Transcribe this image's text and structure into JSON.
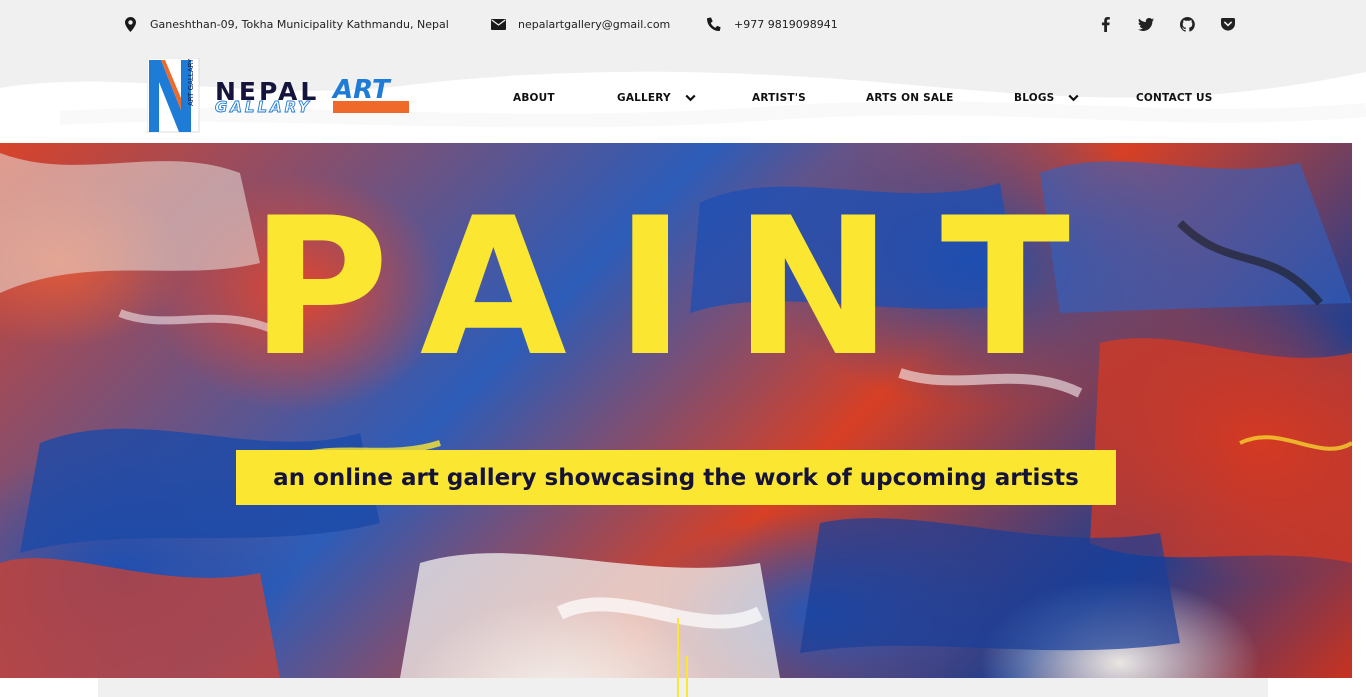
{
  "topbar": {
    "address": "Ganeshthan-09, Tokha Municipality Kathmandu, Nepal",
    "address_icon": "map-marker-icon",
    "email": "nepalartgallery@gmail.com",
    "email_icon": "envelope-icon",
    "phone": "+977 9819098941",
    "phone_icon": "phone-icon",
    "social": [
      {
        "name": "facebook-icon"
      },
      {
        "name": "twitter-icon"
      },
      {
        "name": "github-icon"
      },
      {
        "name": "pocket-icon"
      }
    ]
  },
  "logo": {
    "line1_a": "NEPAL",
    "line1_b": "ART",
    "line2": "GALLARY",
    "vertical": "ART GALLARY",
    "colors": {
      "blue": "#1e7bd6",
      "orange": "#ef6a2a",
      "navy": "#14143c"
    }
  },
  "nav": {
    "items": [
      {
        "label": "ABOUT",
        "dropdown": false
      },
      {
        "label": "GALLERY",
        "dropdown": true
      },
      {
        "label": "ARTIST'S",
        "dropdown": false
      },
      {
        "label": "ARTS ON SALE",
        "dropdown": false
      },
      {
        "label": "BLOGS",
        "dropdown": true
      },
      {
        "label": "CONTACT US",
        "dropdown": false
      }
    ]
  },
  "hero": {
    "title": "PAINT",
    "tagline": "an online art gallery showcasing the work of upcoming artists",
    "accent": "#fbe731",
    "tagline_color": "#15133a"
  }
}
